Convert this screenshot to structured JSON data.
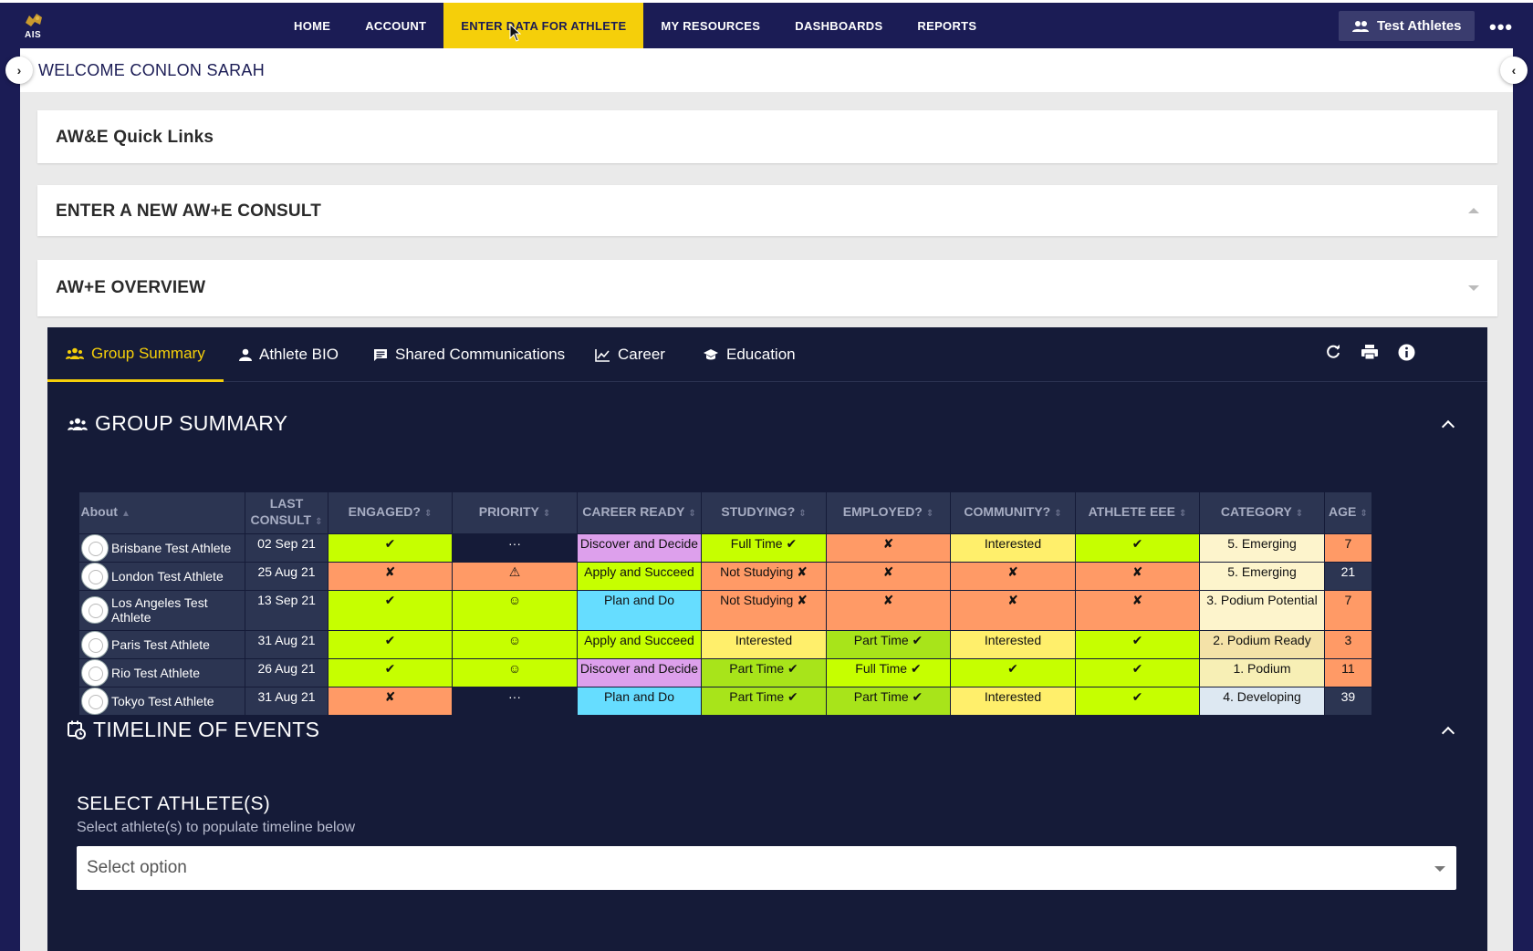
{
  "nav": {
    "logo_text": "AIS",
    "items": [
      {
        "label": "HOME"
      },
      {
        "label": "ACCOUNT"
      },
      {
        "label": "ENTER DATA FOR ATHLETE"
      },
      {
        "label": "MY RESOURCES"
      },
      {
        "label": "DASHBOARDS"
      },
      {
        "label": "REPORTS"
      }
    ],
    "athletes_button": "Test Athletes",
    "more": "•••"
  },
  "welcome": "WELCOME CONLON SARAH",
  "panels": {
    "quick_links": "AW&E Quick Links",
    "new_consult": "ENTER A NEW AW+E CONSULT",
    "overview": "AW+E OVERVIEW"
  },
  "tabs": [
    {
      "label": "Group Summary",
      "icon": "group-icon"
    },
    {
      "label": "Athlete BIO",
      "icon": "person-icon"
    },
    {
      "label": "Shared Communications",
      "icon": "comment-icon"
    },
    {
      "label": "Career",
      "icon": "chart-icon"
    },
    {
      "label": "Education",
      "icon": "graduation-cap-icon"
    }
  ],
  "group_summary": {
    "title": "GROUP SUMMARY",
    "columns": [
      "About",
      "LAST CONSULT",
      "ENGAGED?",
      "PRIORITY",
      "CAREER READY",
      "STUDYING?",
      "EMPLOYED?",
      "COMMUNITY?",
      "ATHLETE EEE",
      "CATEGORY",
      "AGE"
    ],
    "rows": [
      {
        "name": "Brisbane Test Athlete",
        "last": "02 Sep 21",
        "engaged": "✔",
        "priority": "···",
        "career": "Discover and Decide",
        "studying": "Full Time ✔",
        "employed": "✘",
        "community": "Interested",
        "eee": "✔",
        "category": "5. Emerging",
        "age": "7"
      },
      {
        "name": "London Test Athlete",
        "last": "25 Aug 21",
        "engaged": "✘",
        "priority": "⚠",
        "career": "Apply and Succeed",
        "studying": "Not Studying ✘",
        "employed": "✘",
        "community": "✘",
        "eee": "✘",
        "category": "5. Emerging",
        "age": "21"
      },
      {
        "name": "Los Angeles Test Athlete",
        "last": "13 Sep 21",
        "engaged": "✔",
        "priority": "☺",
        "career": "Plan and Do",
        "studying": "Not Studying ✘",
        "employed": "✘",
        "community": "✘",
        "eee": "✘",
        "category": "3. Podium Potential",
        "age": "7"
      },
      {
        "name": "Paris Test Athlete",
        "last": "31 Aug 21",
        "engaged": "✔",
        "priority": "☺",
        "career": "Apply and Succeed",
        "studying": "Interested",
        "employed": "Part Time ✔",
        "community": "Interested",
        "eee": "✔",
        "category": "2. Podium Ready",
        "age": "3"
      },
      {
        "name": "Rio Test Athlete",
        "last": "26 Aug 21",
        "engaged": "✔",
        "priority": "☺",
        "career": "Discover and Decide",
        "studying": "Part Time ✔",
        "employed": "Full Time ✔",
        "community": "✔",
        "eee": "✔",
        "category": "1. Podium",
        "age": "11"
      },
      {
        "name": "Tokyo Test Athlete",
        "last": "31 Aug 21",
        "engaged": "✘",
        "priority": "···",
        "career": "Plan and Do",
        "studying": "Part Time ✔",
        "employed": "Part Time ✔",
        "community": "Interested",
        "eee": "✔",
        "category": "4. Developing",
        "age": "39"
      }
    ]
  },
  "timeline": {
    "title": "TIMELINE OF EVENTS",
    "select_label": "SELECT ATHLETE(S)",
    "select_help": "Select athlete(s) to populate timeline below",
    "select_placeholder": "Select option"
  },
  "colors": {
    "navy": "#1b1c55",
    "accent_yellow": "#f5cf0a",
    "card_dark": "#151b38"
  }
}
